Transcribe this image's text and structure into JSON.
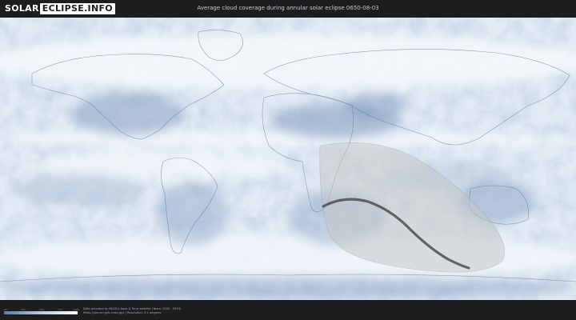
{
  "header": {
    "logo_solar": "SOLAR",
    "logo_eclipse": "ECLIPSE.INFO",
    "title": "Average cloud coverage during annular solar eclipse 0650-08-03"
  },
  "legend": {
    "ticks": [
      "0%",
      "25%",
      "50%",
      "75%",
      "100%"
    ],
    "colors": {
      "low": "#5a7aa6",
      "mid": "#b7c9dc",
      "high": "#ffffff"
    }
  },
  "credits": {
    "line1": "Data provided by NASA's Aqua & Terra satellite (Years: 2000 - 2019)",
    "line2": "https://neo.sci.gsfc.nasa.gov | Resolution: 0.1 degrees"
  },
  "colors": {
    "background": "#1c1d1f",
    "ocean_base": "#e3ebf4",
    "cloud_low": "#6d8cb6",
    "eclipse_zone": "#c6c8c9",
    "path": "#4d4d50"
  }
}
